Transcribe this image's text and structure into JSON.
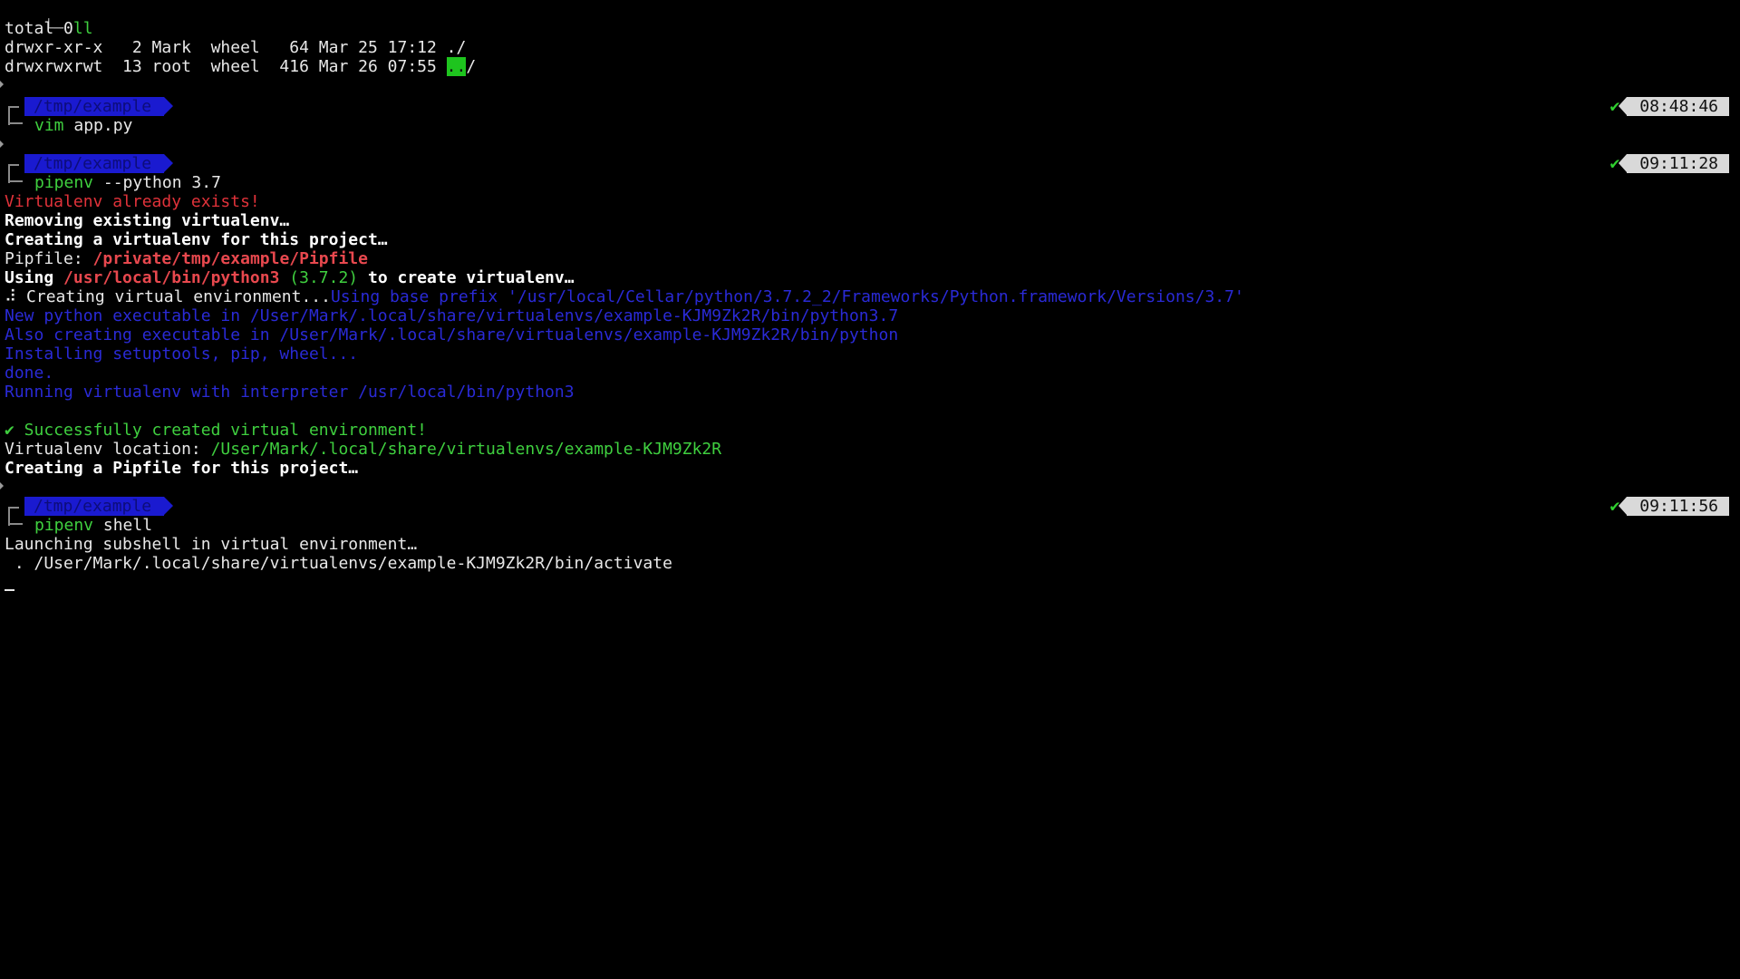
{
  "colors": {
    "background": "#000000",
    "prompt_dir_bg": "#1a1ad0",
    "success_green": "#3fcf3f",
    "error_red": "#e0323a",
    "verbose_blue": "#2a2ad6",
    "time_pill_bg": "#d9d9d9"
  },
  "ls_block": {
    "command": "ll",
    "total": "total 0",
    "row1": "drwxr-xr-x   2 Mark  wheel   64 Mar 25 17:12 ./",
    "row2_prefix": "drwxrwxrwt  13 root  wheel  416 Mar 26 07:55 ",
    "row2_dir_highlight": "..",
    "row2_suffix": "/"
  },
  "prompt1": {
    "dir": "/tmp/example",
    "command_name": "vim",
    "command_args": " app.py",
    "status_icon": "check-icon",
    "time": "08:48:46"
  },
  "prompt2": {
    "dir": "/tmp/example",
    "command_name": "pipenv",
    "command_args": " --python 3.7",
    "status_icon": "check-icon",
    "time": "09:11:28"
  },
  "pipenv_output": {
    "already_exists": "Virtualenv already exists!",
    "removing": "Removing existing virtualenv…",
    "creating": "Creating a virtualenv for this project…",
    "pipfile_label": "Pipfile: ",
    "pipfile_path": "/private/tmp/example/Pipfile",
    "using_label": "Using ",
    "using_path": "/usr/local/bin/python3",
    "using_version": " (3.7.2)",
    "using_suffix": " to create virtualenv…",
    "creating_env_prefix": "⠼ Creating virtual environment...",
    "base_prefix": "Using base prefix '/usr/local/Cellar/python/3.7.2_2/Frameworks/Python.framework/Versions/3.7'",
    "new_python": "New python executable in /User/Mark/.local/share/virtualenvs/example-KJM9Zk2R/bin/python3.7",
    "also_creating": "Also creating executable in /User/Mark/.local/share/virtualenvs/example-KJM9Zk2R/bin/python",
    "installing": "Installing setuptools, pip, wheel...",
    "done": "done.",
    "running": "Running virtualenv with interpreter /usr/local/bin/python3",
    "success": "✔ Successfully created virtual environment!",
    "location_label": "Virtualenv location: ",
    "location_path": "/User/Mark/.local/share/virtualenvs/example-KJM9Zk2R",
    "creating_pipfile": "Creating a Pipfile for this project…"
  },
  "prompt3": {
    "dir": "/tmp/example",
    "command_name": "pipenv",
    "command_args": " shell",
    "status_icon": "check-icon",
    "time": "09:11:56"
  },
  "shell_output": {
    "launching": "Launching subshell in virtual environment…",
    "activate": " . /User/Mark/.local/share/virtualenvs/example-KJM9Zk2R/bin/activate"
  },
  "cursor_char": "_"
}
